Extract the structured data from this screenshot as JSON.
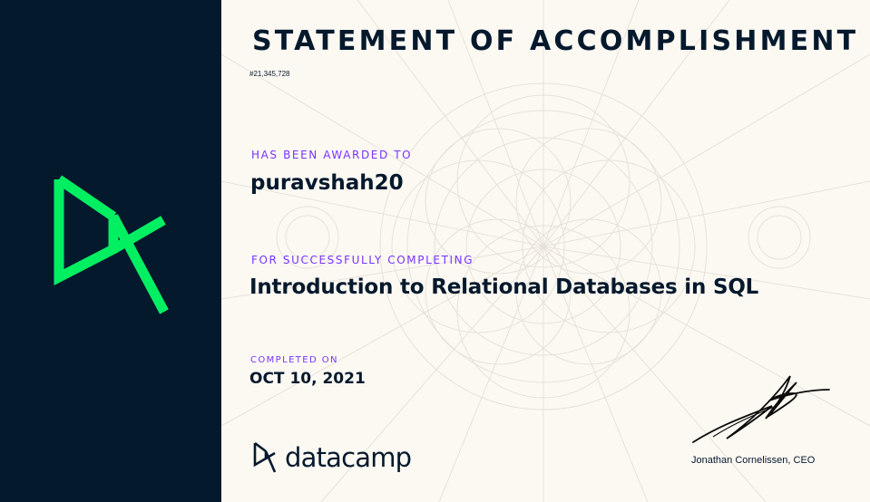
{
  "certificate": {
    "heading": "STATEMENT OF ACCOMPLISHMENT",
    "certificate_id": "#21,345,728",
    "awarded_label": "HAS BEEN AWARDED TO",
    "recipient": "puravshah20",
    "completing_label": "FOR SUCCESSFULLY COMPLETING",
    "course_title": "Introduction to Relational Databases in SQL",
    "completed_label": "COMPLETED ON",
    "completed_date": "OCT 10, 2021",
    "signer": "Jonathan Cornelissen, CEO"
  },
  "brand": {
    "name": "datacamp",
    "logo_icon": "datacamp-logo-icon",
    "accent_color": "#03ef62",
    "sidebar_color": "#05192d",
    "highlight_color": "#7933ff"
  }
}
